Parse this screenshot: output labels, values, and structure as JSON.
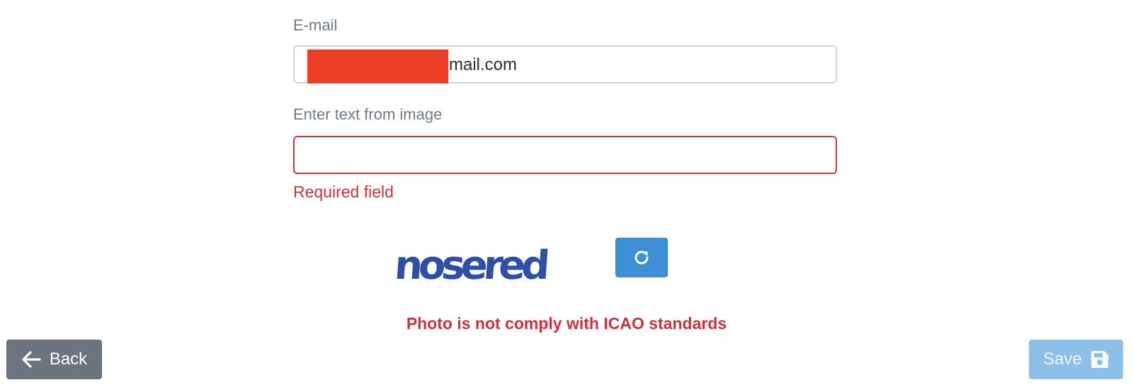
{
  "form": {
    "email_label": "E-mail",
    "email_value": "mail.com",
    "captcha_label": "Enter text from image",
    "captcha_value": "",
    "captcha_error": "Required field",
    "captcha_image_text": "nosered"
  },
  "warning": "Photo is not comply with ICAO standards",
  "footer": {
    "back_label": "Back",
    "save_label": "Save"
  },
  "icons": {
    "refresh": "refresh-icon",
    "back": "arrow-left-icon",
    "save": "floppy-disk-icon"
  },
  "colors": {
    "error": "#d0303a",
    "refresh_button": "#3d8fd6",
    "back_button": "#6c757d",
    "save_button_disabled": "#8dc0e8",
    "redaction": "#ec3f25"
  }
}
